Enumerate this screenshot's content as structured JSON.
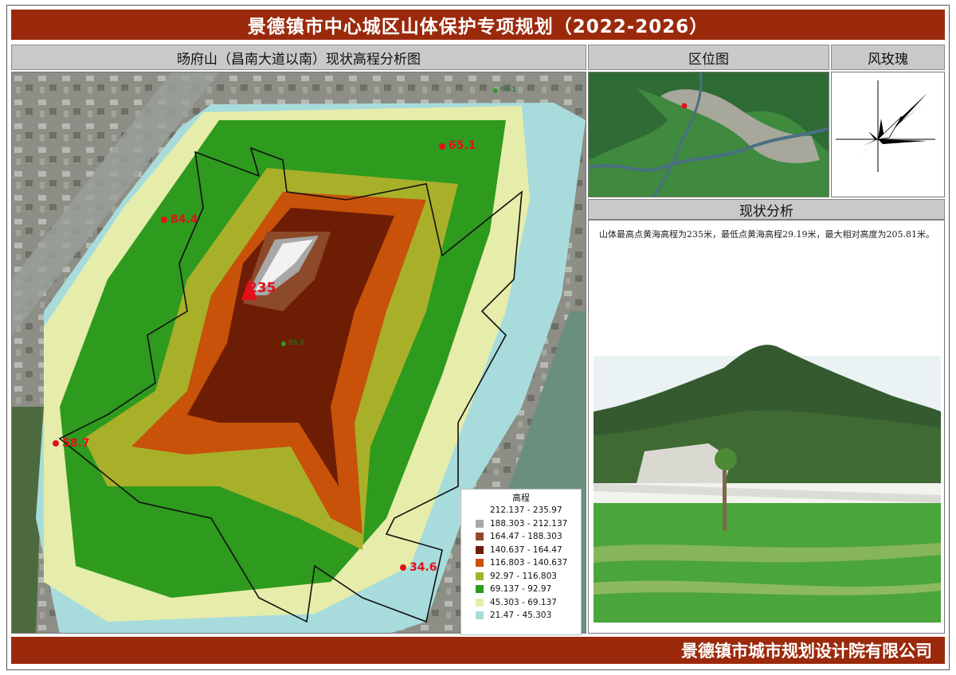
{
  "title": "景德镇市中心城区山体保护专项规划（2022-2026）",
  "map_panel": {
    "heading": "旸府山（昌南大道以南）现状高程分析图",
    "peaks": [
      {
        "id": "summit",
        "label": "235"
      },
      {
        "id": "north-east",
        "label": "65.1"
      },
      {
        "id": "north-east-small",
        "label": "65.1"
      },
      {
        "id": "north-west",
        "label": "84.4"
      },
      {
        "id": "west",
        "label": "58.7"
      },
      {
        "id": "south-east",
        "label": "34.6"
      },
      {
        "id": "center-small",
        "label": "88.8"
      }
    ],
    "legend": {
      "title": "高程",
      "items": [
        {
          "range": "212.137 - 235.97",
          "color": "#ffffff"
        },
        {
          "range": "188.303 - 212.137",
          "color": "#a8a8a8"
        },
        {
          "range": "164.47 - 188.303",
          "color": "#8c4a2a"
        },
        {
          "range": "140.637 - 164.47",
          "color": "#6e1d05"
        },
        {
          "range": "116.803 - 140.637",
          "color": "#c8520a"
        },
        {
          "range": "92.97 - 116.803",
          "color": "#a8b02a"
        },
        {
          "range": "69.137 - 92.97",
          "color": "#2e9a1e"
        },
        {
          "range": "45.303 - 69.137",
          "color": "#e6edaa"
        },
        {
          "range": "21.47 - 45.303",
          "color": "#a8dcdc"
        }
      ]
    }
  },
  "location_panel": {
    "heading": "区位图"
  },
  "wind_panel": {
    "heading": "风玫瑰"
  },
  "analysis_panel": {
    "heading": "现状分析",
    "text": "山体最高点黄海高程为235米，最低点黄海高程29.19米，最大相对高度为205.81米。"
  },
  "footer": "景德镇市城市规划设计院有限公司"
}
